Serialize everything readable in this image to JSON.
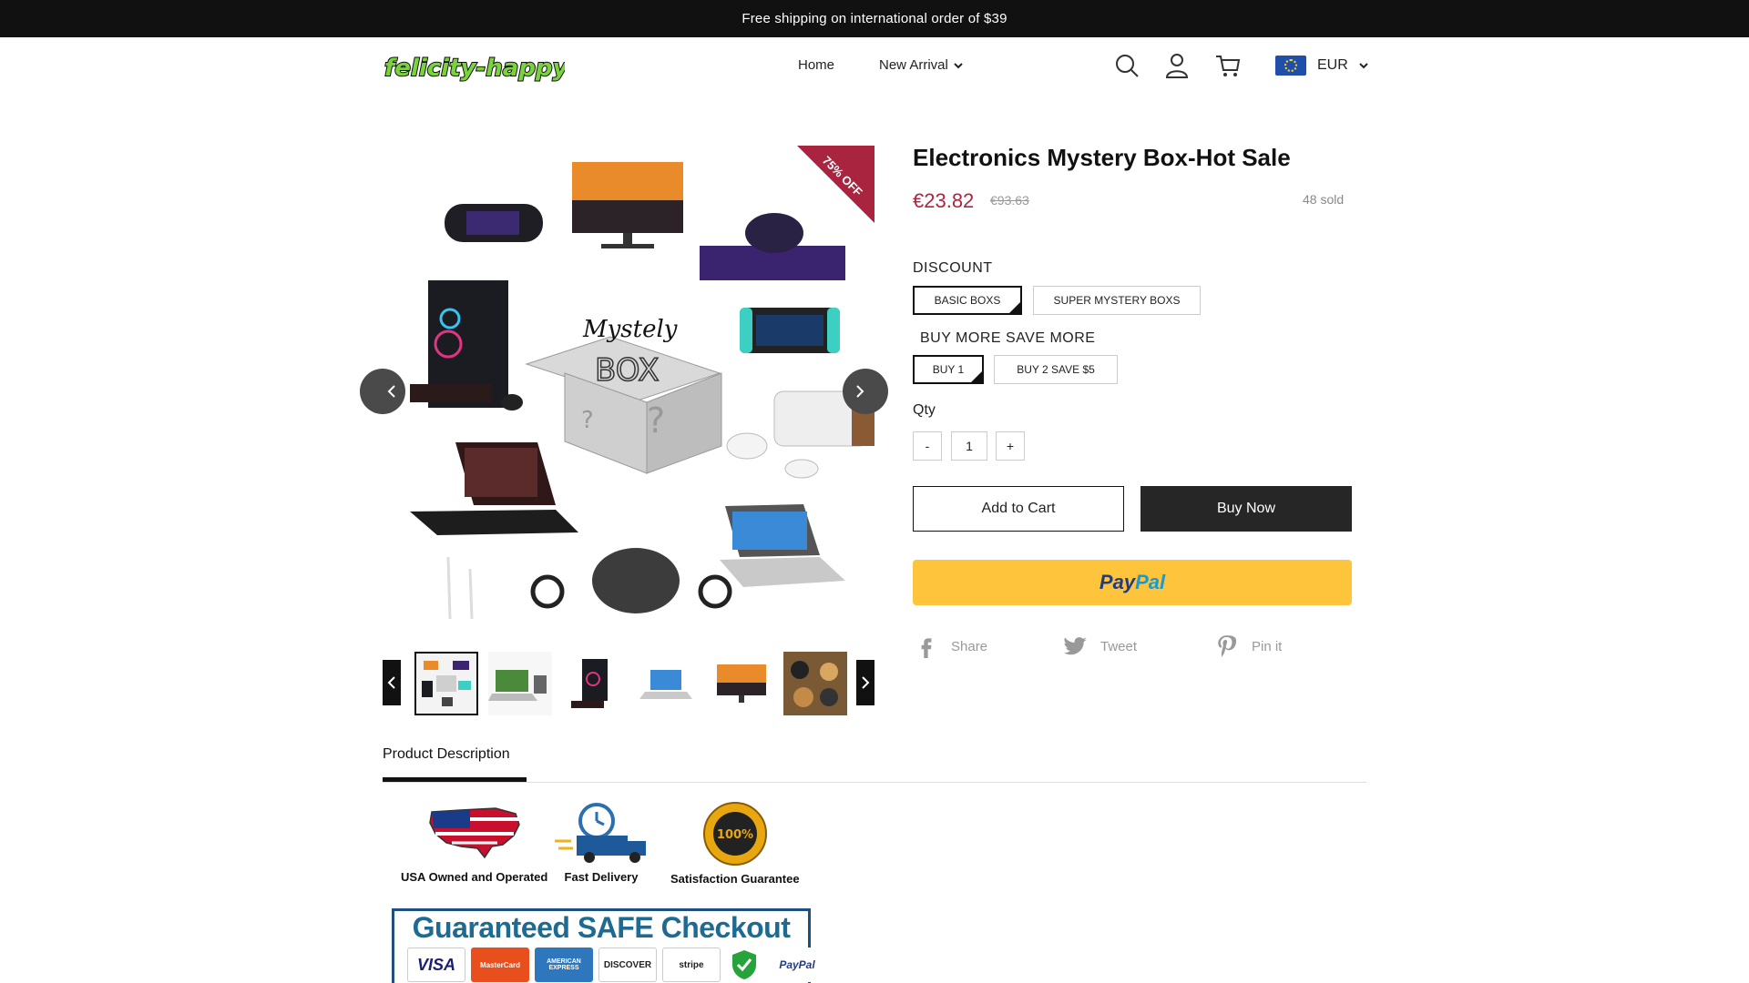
{
  "promo_bar": {
    "text": "Free shipping on international order of $39"
  },
  "header": {
    "logo_text": "felicity-happy",
    "nav": {
      "home": "Home",
      "new_arrival": "New Arrival"
    },
    "icons": {
      "search": "search-icon",
      "account": "user-icon",
      "cart": "cart-icon"
    },
    "currency": {
      "code": "EUR",
      "flag": "eu-flag-icon"
    }
  },
  "gallery": {
    "badge": "75% OFF",
    "main_image_text": [
      "Mystely",
      "BOX",
      "?",
      "?"
    ],
    "thumbnails": [
      "mystery-box-collage",
      "laptop-with-accessories",
      "gaming-pc",
      "laptop",
      "monitor",
      "headphones-collage"
    ],
    "active_thumbnail": 0
  },
  "product": {
    "title": "Electronics Mystery Box-Hot Sale",
    "price": "€23.82",
    "price_original": "€93.63",
    "sold": "48 sold"
  },
  "options": {
    "discount": {
      "label": "DISCOUNT",
      "values": [
        "BASIC BOXS",
        "SUPER MYSTERY BOXS"
      ],
      "selected": "BASIC BOXS"
    },
    "bundle": {
      "label": "BUY MORE SAVE MORE",
      "values": [
        "BUY 1",
        "BUY 2 SAVE $5"
      ],
      "selected": "BUY 1"
    }
  },
  "quantity": {
    "label": "Qty",
    "minus": "-",
    "value": "1",
    "plus": "+"
  },
  "actions": {
    "add_to_cart": "Add to Cart",
    "buy_now": "Buy Now",
    "paypal_pay": "Pay",
    "paypal_pal": "Pal"
  },
  "share": {
    "facebook": "Share",
    "twitter": "Tweet",
    "pinterest": "Pin it"
  },
  "tabs": {
    "description": "Product Description"
  },
  "description": {
    "trust_badges": [
      "USA Owned and Operated",
      "Fast Delivery",
      "Satisfaction Guarantee"
    ],
    "guarantee_seal": "100%",
    "checkout_title": "Guaranteed SAFE Checkout",
    "payment_marks": [
      "VISA",
      "MasterCard",
      "AMERICAN EXPRESS",
      "DISCOVER",
      "stripe",
      "PayPal"
    ]
  },
  "colors": {
    "accent": "#b0243e",
    "paypal": "#fec43c",
    "dark": "#111111"
  }
}
